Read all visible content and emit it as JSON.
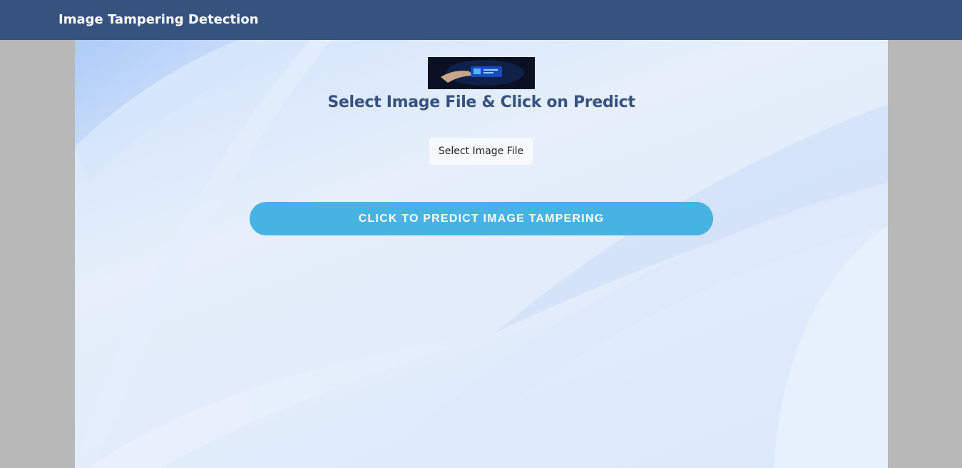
{
  "navbar": {
    "brand": "Image Tampering Detection"
  },
  "main": {
    "banner_image_alt": "hand holding digital image",
    "heading": "Select Image File & Click on Predict",
    "file_button_label": "Select Image File",
    "predict_button_label": "CLICK TO PREDICT IMAGE TAMPERING"
  },
  "colors": {
    "navbar": "#36527f",
    "heading": "#36527f",
    "predict_button": "#47b3e3",
    "page_gutter": "#b8b8b8"
  }
}
